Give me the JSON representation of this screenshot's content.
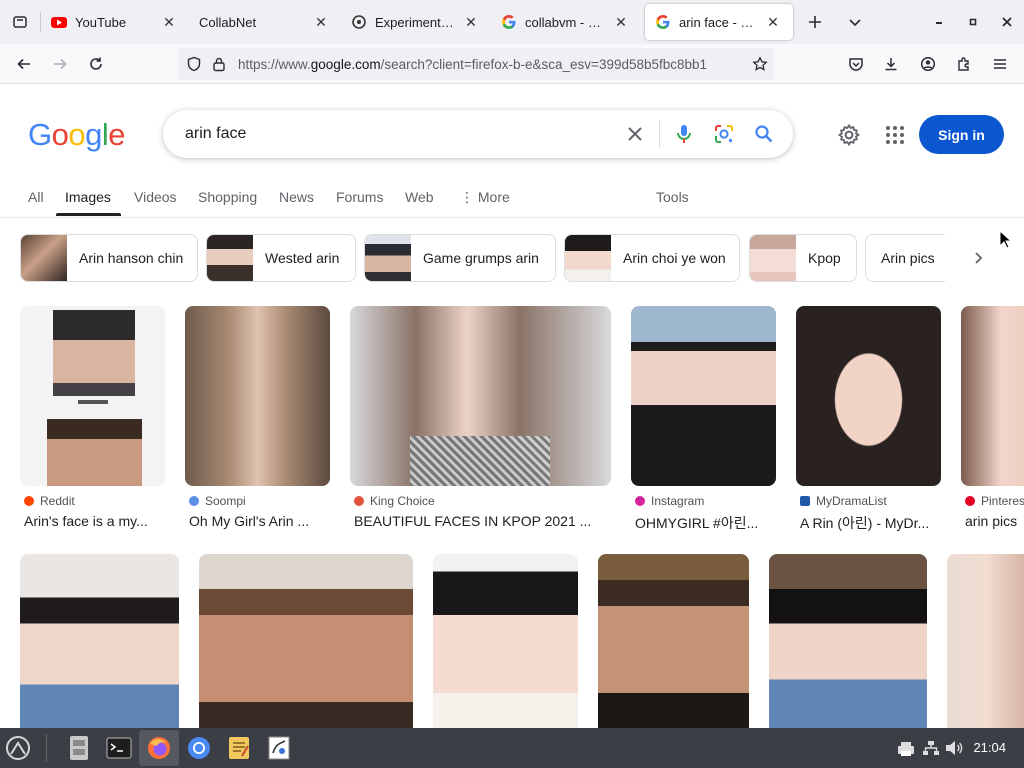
{
  "browser": {
    "tabs": [
      {
        "label": "YouTube",
        "icon": "youtube-icon"
      },
      {
        "label": "CollabNet",
        "icon": ""
      },
      {
        "label": "ExperimentalVI",
        "icon": "vm-icon"
      },
      {
        "label": "collabvm - Goo",
        "icon": "google-g-icon"
      },
      {
        "label": "arin face - Goo",
        "icon": "google-g-icon",
        "active": true
      }
    ],
    "url_prefix": "https://www.",
    "url_host": "google.com",
    "url_rest": "/search?client=firefox-b-e&sca_esv=399d58b5fbc8bb1"
  },
  "google": {
    "logo_letters": [
      "G",
      "o",
      "o",
      "g",
      "l",
      "e"
    ],
    "logo_colors": [
      "#4285F4",
      "#EA4335",
      "#FBBC05",
      "#4285F4",
      "#34A853",
      "#EA4335"
    ],
    "query": "arin face",
    "signin_label": "Sign in",
    "search_tabs": [
      "All",
      "Images",
      "Videos",
      "Shopping",
      "News",
      "Forums",
      "Web",
      "More"
    ],
    "tools_label": "Tools",
    "accent_color": "#0b57d0"
  },
  "chips": [
    {
      "label": "Arin hanson chin"
    },
    {
      "label": "Wested arin"
    },
    {
      "label": "Game grumps arin"
    },
    {
      "label": "Arin choi ye won"
    },
    {
      "label": "Kpop"
    },
    {
      "label": "Arin pics"
    }
  ],
  "results_row1": [
    {
      "source": "Reddit",
      "title": "Arin's face is a my...",
      "fav": "#ff4500"
    },
    {
      "source": "Soompi",
      "title": "Oh My Girl's Arin ...",
      "fav": "#5b8ee6"
    },
    {
      "source": "King Choice",
      "title": "BEAUTIFUL FACES IN KPOP 2021 ...",
      "fav": "#e2533b"
    },
    {
      "source": "Instagram",
      "title": "OHMYGIRL #아린...",
      "fav": "#d6249f"
    },
    {
      "source": "MyDramaList",
      "title": "A Rin (아린) - MyDr...",
      "fav": "#1e5aa8"
    },
    {
      "source": "Pinterest",
      "title": "arin pics",
      "fav": "#e60023"
    }
  ],
  "taskbar": {
    "clock": "21:04"
  }
}
